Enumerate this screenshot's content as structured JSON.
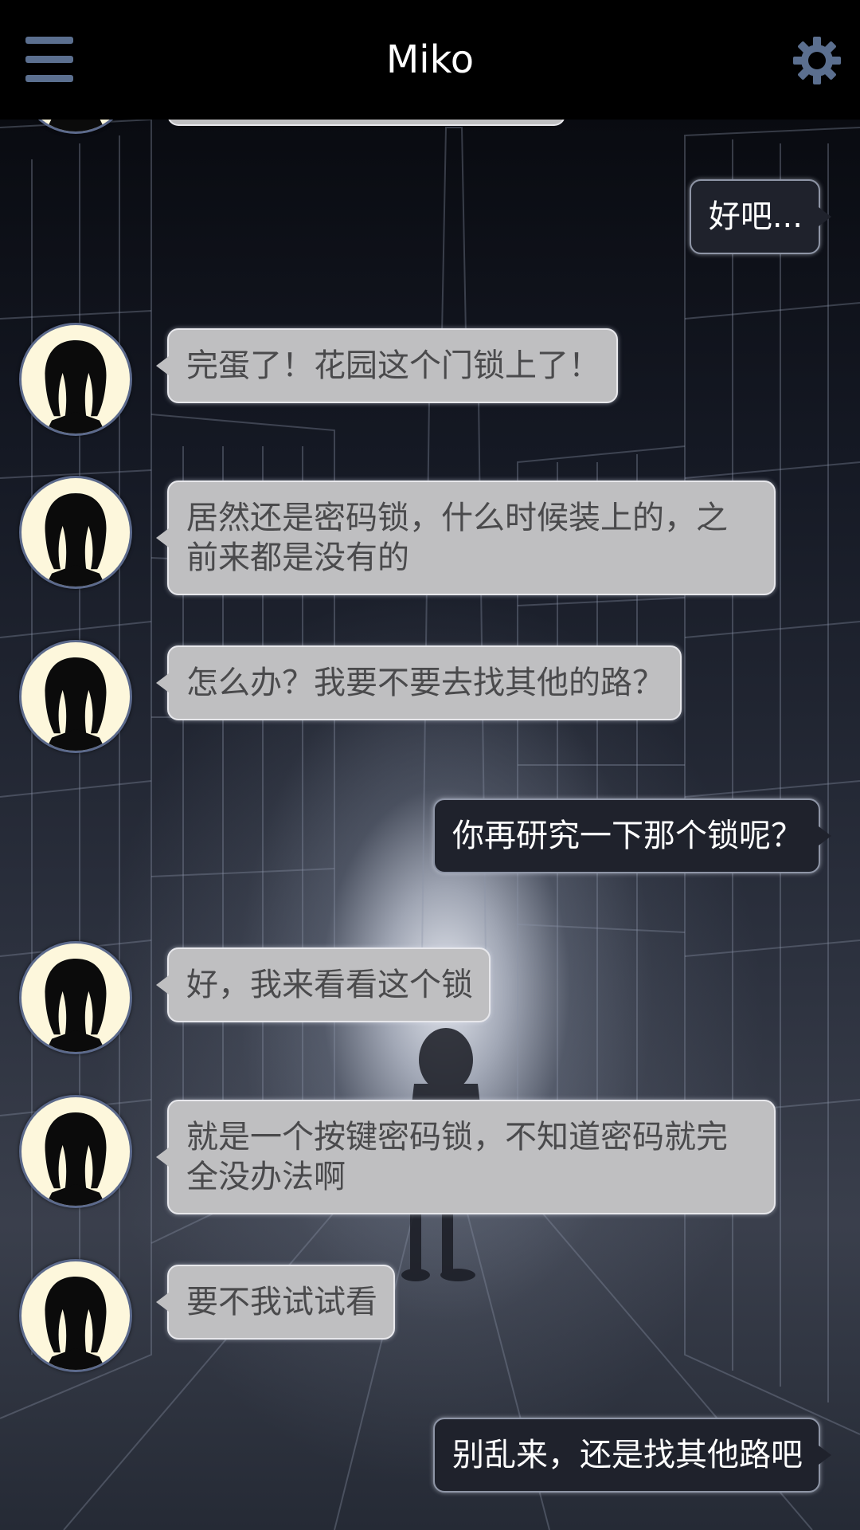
{
  "header": {
    "title": "Miko",
    "menu_icon": "hamburger-menu-icon",
    "settings_icon": "gear-icon"
  },
  "colors": {
    "header_bg": "#000000",
    "icon_accent": "#5b6f8f",
    "left_bubble_bg": "#bfbfc1",
    "left_bubble_text": "#4a4a4c",
    "right_bubble_bg": "#1f222c",
    "right_bubble_text": "#ffffff",
    "avatar_bg": "#fdf7dc"
  },
  "messages": [
    {
      "sender": "me",
      "text": "好吧..."
    },
    {
      "sender": "miko",
      "text": "完蛋了！花园这个门锁上了！"
    },
    {
      "sender": "miko",
      "text": "居然还是密码锁，什么时候装上的，之前来都是没有的"
    },
    {
      "sender": "miko",
      "text": "怎么办？我要不要去找其他的路？"
    },
    {
      "sender": "me",
      "text": "你再研究一下那个锁呢？"
    },
    {
      "sender": "miko",
      "text": "好，我来看看这个锁"
    },
    {
      "sender": "miko",
      "text": "就是一个按键密码锁，不知道密码就完全没办法啊"
    },
    {
      "sender": "miko",
      "text": "要不我试试看"
    },
    {
      "sender": "me",
      "text": "别乱来，还是找其他路吧"
    }
  ]
}
